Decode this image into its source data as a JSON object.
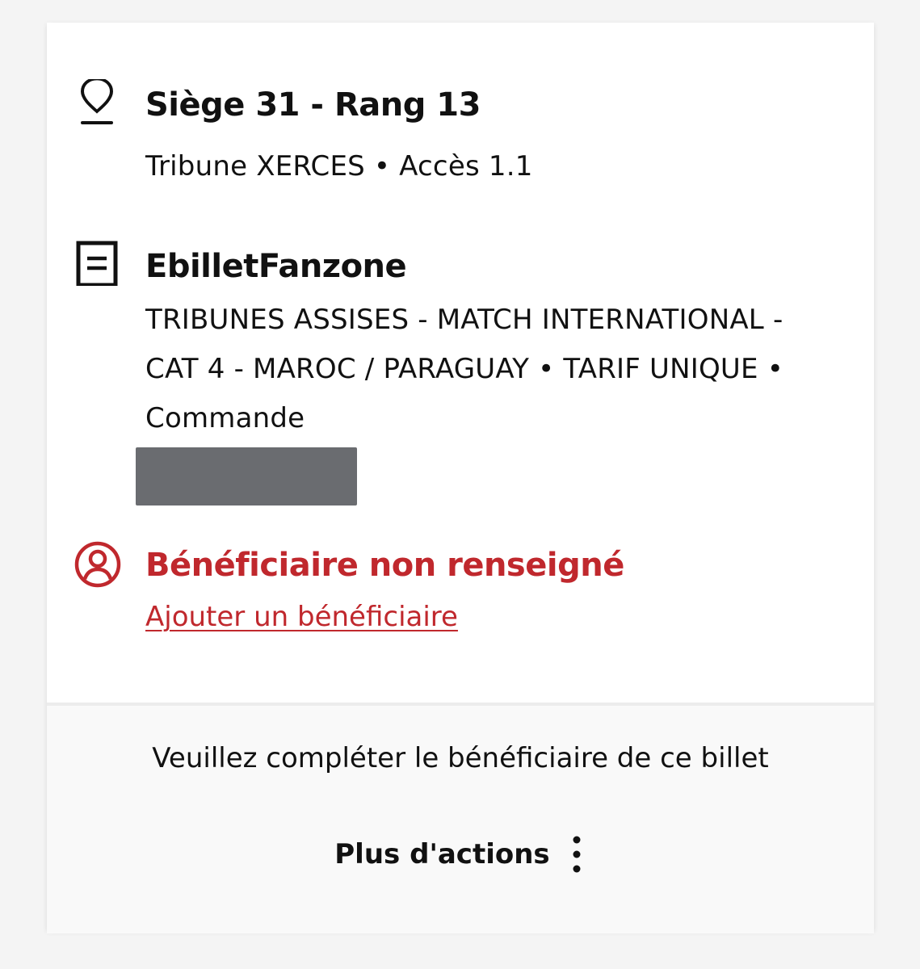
{
  "seat": {
    "icon": "map-pin-icon",
    "title": "Siège 31 - Rang 13",
    "subtitle": "Tribune XERCES • Accès 1.1"
  },
  "product": {
    "icon": "document-icon",
    "title": "EbilletFanzone",
    "description": "TRIBUNES ASSISES - MATCH INTERNATIONAL - CAT 4 - MAROC / PARAGUAY • TARIF UNIQUE • Commande"
  },
  "beneficiary": {
    "icon": "user-circle-icon",
    "title": "Bénéficiaire non renseigné",
    "link_label": "Ajouter un bénéficiaire"
  },
  "footer": {
    "notice": "Veuillez compléter le bénéficiaire de ce billet",
    "actions_label": "Plus d'actions",
    "actions_icon": "more-vertical-icon"
  },
  "colors": {
    "accent_red": "#c0282d",
    "text": "#111111",
    "card_bg": "#ffffff",
    "footer_bg": "#f9f9f9",
    "page_bg": "#f4f4f4"
  }
}
